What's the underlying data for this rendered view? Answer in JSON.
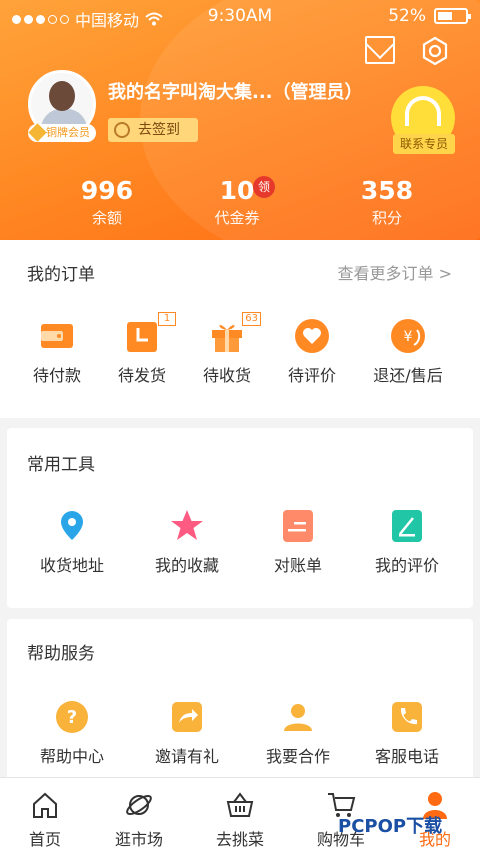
{
  "status_bar": {
    "carrier": "中国移动",
    "time": "9:30AM",
    "battery": "52%"
  },
  "profile": {
    "member_badge": "铜牌会员",
    "username": "我的名字叫淘大集...（管理员）",
    "checkin_label": "去签到",
    "service_label": "联系专员"
  },
  "stats": [
    {
      "value": "996",
      "label": "余额"
    },
    {
      "value": "10",
      "label": "代金券"
    },
    {
      "value": "358",
      "label": "积分"
    }
  ],
  "coupon_badge": "领",
  "orders": {
    "title": "我的订单",
    "more": "查看更多订单 >",
    "items": [
      {
        "label": "待付款",
        "icon": "wallet-icon",
        "badge": ""
      },
      {
        "label": "待发货",
        "icon": "clock-icon",
        "badge": "1"
      },
      {
        "label": "待收货",
        "icon": "gift-icon",
        "badge": "63"
      },
      {
        "label": "待评价",
        "icon": "heart-icon",
        "badge": ""
      },
      {
        "label": "退还/售后",
        "icon": "refund-icon",
        "badge": ""
      }
    ]
  },
  "tools": {
    "title": "常用工具",
    "items": [
      {
        "label": "收货地址",
        "icon": "location-pin-icon"
      },
      {
        "label": "我的收藏",
        "icon": "star-icon"
      },
      {
        "label": "对账单",
        "icon": "statement-icon"
      },
      {
        "label": "我的评价",
        "icon": "edit-icon"
      }
    ]
  },
  "help": {
    "title": "帮助服务",
    "items": [
      {
        "label": "帮助中心",
        "icon": "question-icon"
      },
      {
        "label": "邀请有礼",
        "icon": "share-icon"
      },
      {
        "label": "我要合作",
        "icon": "person-icon"
      },
      {
        "label": "客服电话",
        "icon": "phone-icon"
      }
    ]
  },
  "tabbar": [
    {
      "label": "首页",
      "icon": "home-icon"
    },
    {
      "label": "逛市场",
      "icon": "planet-icon"
    },
    {
      "label": "去挑菜",
      "icon": "basket-icon"
    },
    {
      "label": "购物车",
      "icon": "cart-icon"
    },
    {
      "label": "我的",
      "icon": "user-icon"
    }
  ],
  "watermark": "PCPOP下载",
  "colors": {
    "accent": "#ff7a1e",
    "orange_dark": "#ff6a12",
    "header_light": "#ffa33a"
  }
}
